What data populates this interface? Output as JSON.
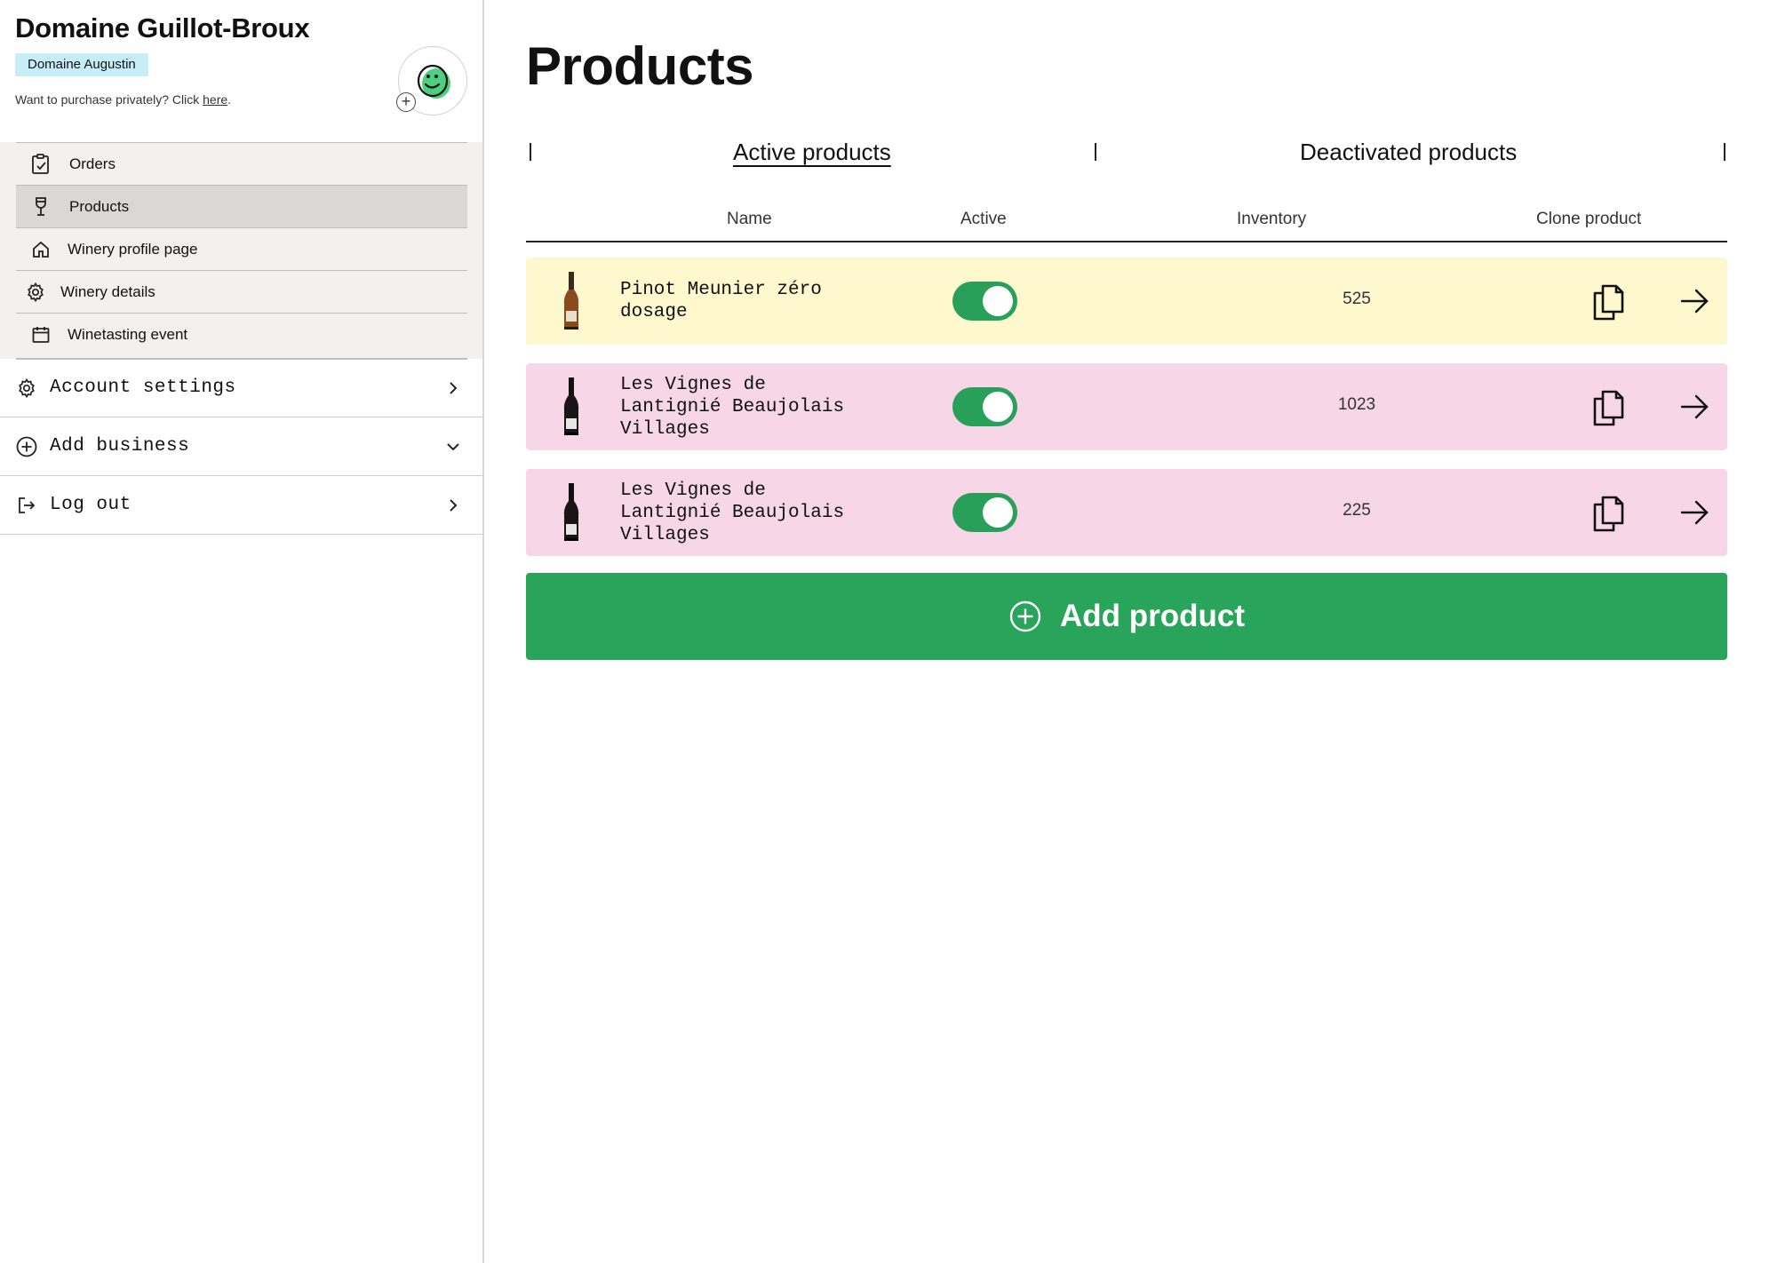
{
  "sidebar": {
    "brand_title": "Domaine Guillot-Broux",
    "brand_badge": "Domaine Augustin",
    "private_note": "Want to purchase privately? Click ",
    "private_link": "here",
    "private_suffix": ".",
    "nav": [
      {
        "label": "Orders",
        "icon": "clipboard-check-icon"
      },
      {
        "label": "Products",
        "icon": "wine-glass-icon",
        "selected": true
      },
      {
        "label": "Winery profile page",
        "icon": "home-icon"
      },
      {
        "label": "Winery details",
        "icon": "gear-icon"
      },
      {
        "label": "Winetasting event",
        "icon": "calendar-icon"
      }
    ],
    "accordion": [
      {
        "label": "Account settings",
        "icon": "gear-icon",
        "chevron": "chevron-right-icon"
      },
      {
        "label": "Add business",
        "icon": "plus-circle-icon",
        "chevron": "chevron-down-icon"
      },
      {
        "label": "Log out",
        "icon": "logout-icon",
        "chevron": "chevron-right-icon"
      }
    ]
  },
  "main": {
    "title": "Products",
    "tabs": [
      {
        "label": "Active products",
        "active": true
      },
      {
        "label": "Deactivated products",
        "active": false
      }
    ],
    "columns": [
      "Name",
      "Active",
      "Inventory",
      "Clone product"
    ],
    "products": [
      {
        "name_line1": "Pinot Meunier zéro",
        "name_line2": "dosage",
        "name_line3": "",
        "active": true,
        "inventory": "525",
        "row_color": "#fdf8cd"
      },
      {
        "name_line1": "Les Vignes de",
        "name_line2": "Lantignié Beaujolais",
        "name_line3": "Villages",
        "active": true,
        "inventory": "1023",
        "row_color": "#f7d7e7"
      },
      {
        "name_line1": "Les Vignes de",
        "name_line2": "Lantignié Beaujolais",
        "name_line3": "Villages",
        "active": true,
        "inventory": "225",
        "row_color": "#f7d7e7"
      }
    ],
    "add_button": "Add product"
  },
  "colors": {
    "accent_green": "#28a55a",
    "badge_blue": "#c7eef6",
    "row_yellow": "#fdf8cd",
    "row_pink": "#f7d7e7",
    "avatar_green": "#4ccf7e"
  }
}
